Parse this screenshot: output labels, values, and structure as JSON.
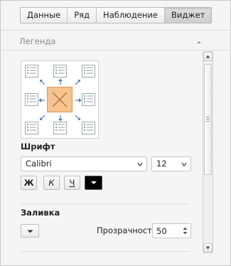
{
  "tabs": [
    {
      "label": "Данные",
      "active": false
    },
    {
      "label": "Ряд",
      "active": false
    },
    {
      "label": "Наблюдение",
      "active": false
    },
    {
      "label": "Виджет",
      "active": true
    }
  ],
  "legend": {
    "title": "Легенда",
    "position_icons": [
      "legend-top-left-icon",
      "legend-top-center-icon",
      "legend-top-right-icon",
      "legend-middle-left-icon",
      "legend-middle-right-icon",
      "legend-bottom-left-icon",
      "legend-bottom-center-icon",
      "legend-bottom-right-icon"
    ],
    "center_icon": "no-legend-icon",
    "accent_color": "#f6c48e"
  },
  "font": {
    "section_label": "Шрифт",
    "family": "Calibri",
    "size": "12",
    "bold_label": "Ж",
    "italic_label": "К",
    "underline_label": "Ч",
    "color": "#000000"
  },
  "fill": {
    "section_label": "Заливка",
    "transparency_label": "Прозрачность",
    "transparency_value": "50"
  }
}
